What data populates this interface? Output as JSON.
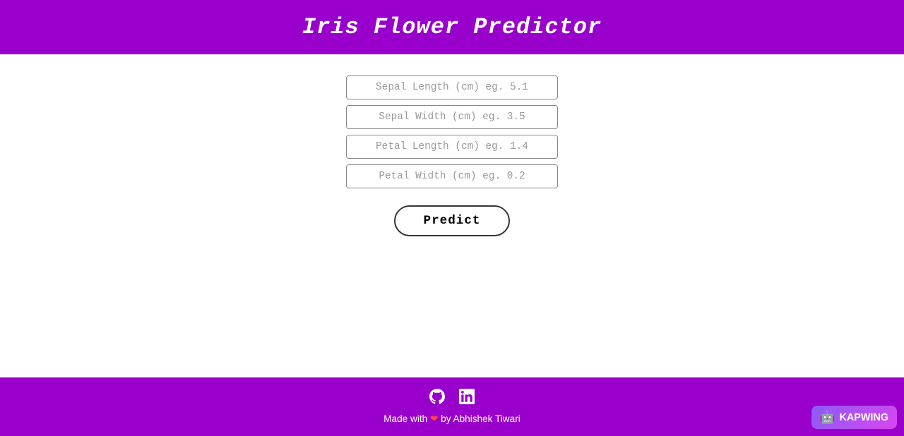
{
  "header": {
    "title": "Iris Flower Predictor"
  },
  "form": {
    "sepal_length_placeholder": "Sepal Length (cm) eg. 5.1",
    "sepal_width_placeholder": "Sepal Width (cm) eg. 3.5",
    "petal_length_placeholder": "Petal Length (cm) eg. 1.4",
    "petal_width_placeholder": "Petal Width (cm) eg. 0.2",
    "predict_button_label": "Predict"
  },
  "footer": {
    "made_with_text": "Made with",
    "by_text": "by Abhishek Tiwari",
    "github_label": "GitHub",
    "linkedin_label": "LinkedIn"
  },
  "watermark": {
    "label": "KAPWING"
  },
  "colors": {
    "brand_purple": "#9900cc",
    "white": "#ffffff",
    "black": "#000000"
  }
}
